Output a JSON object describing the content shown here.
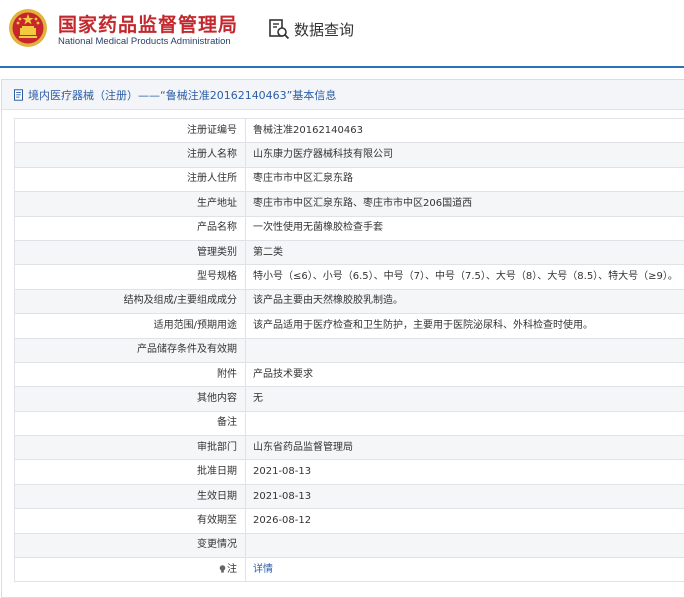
{
  "header": {
    "brand_cn": "国家药品监督管理局",
    "brand_en": "National Medical Products Administration",
    "query_label": "数据查询",
    "accent_color": "#c2282d",
    "line_color": "#2872b8"
  },
  "panel": {
    "title": "境内医疗器械（注册）——“鲁械注准20162140463”基本信息",
    "icon": "document-icon"
  },
  "rows": [
    {
      "label": "注册证编号",
      "value": "鲁械注准20162140463"
    },
    {
      "label": "注册人名称",
      "value": "山东康力医疗器械科技有限公司"
    },
    {
      "label": "注册人住所",
      "value": "枣庄市市中区汇泉东路"
    },
    {
      "label": "生产地址",
      "value": "枣庄市市中区汇泉东路、枣庄市市中区206国道西"
    },
    {
      "label": "产品名称",
      "value": "一次性使用无菌橡胶检查手套"
    },
    {
      "label": "管理类别",
      "value": "第二类"
    },
    {
      "label": "型号规格",
      "value": "特小号（≤6）、小号（6.5）、中号（7）、中号（7.5）、大号（8）、大号（8.5）、特大号（≥9）。"
    },
    {
      "label": "结构及组成/主要组成成分",
      "value": "该产品主要由天然橡胶胶乳制造。"
    },
    {
      "label": "适用范围/预期用途",
      "value": "该产品适用于医疗检查和卫生防护，主要用于医院泌尿科、外科检查时使用。"
    },
    {
      "label": "产品储存条件及有效期",
      "value": ""
    },
    {
      "label": "附件",
      "value": "产品技术要求"
    },
    {
      "label": "其他内容",
      "value": "无"
    },
    {
      "label": "备注",
      "value": ""
    },
    {
      "label": "审批部门",
      "value": "山东省药品监督管理局"
    },
    {
      "label": "批准日期",
      "value": "2021-08-13"
    },
    {
      "label": "生效日期",
      "value": "2021-08-13"
    },
    {
      "label": "有效期至",
      "value": "2026-08-12"
    },
    {
      "label": "变更情况",
      "value": ""
    },
    {
      "label": "注",
      "value": "详情",
      "icon": "lightbulb-icon"
    }
  ]
}
